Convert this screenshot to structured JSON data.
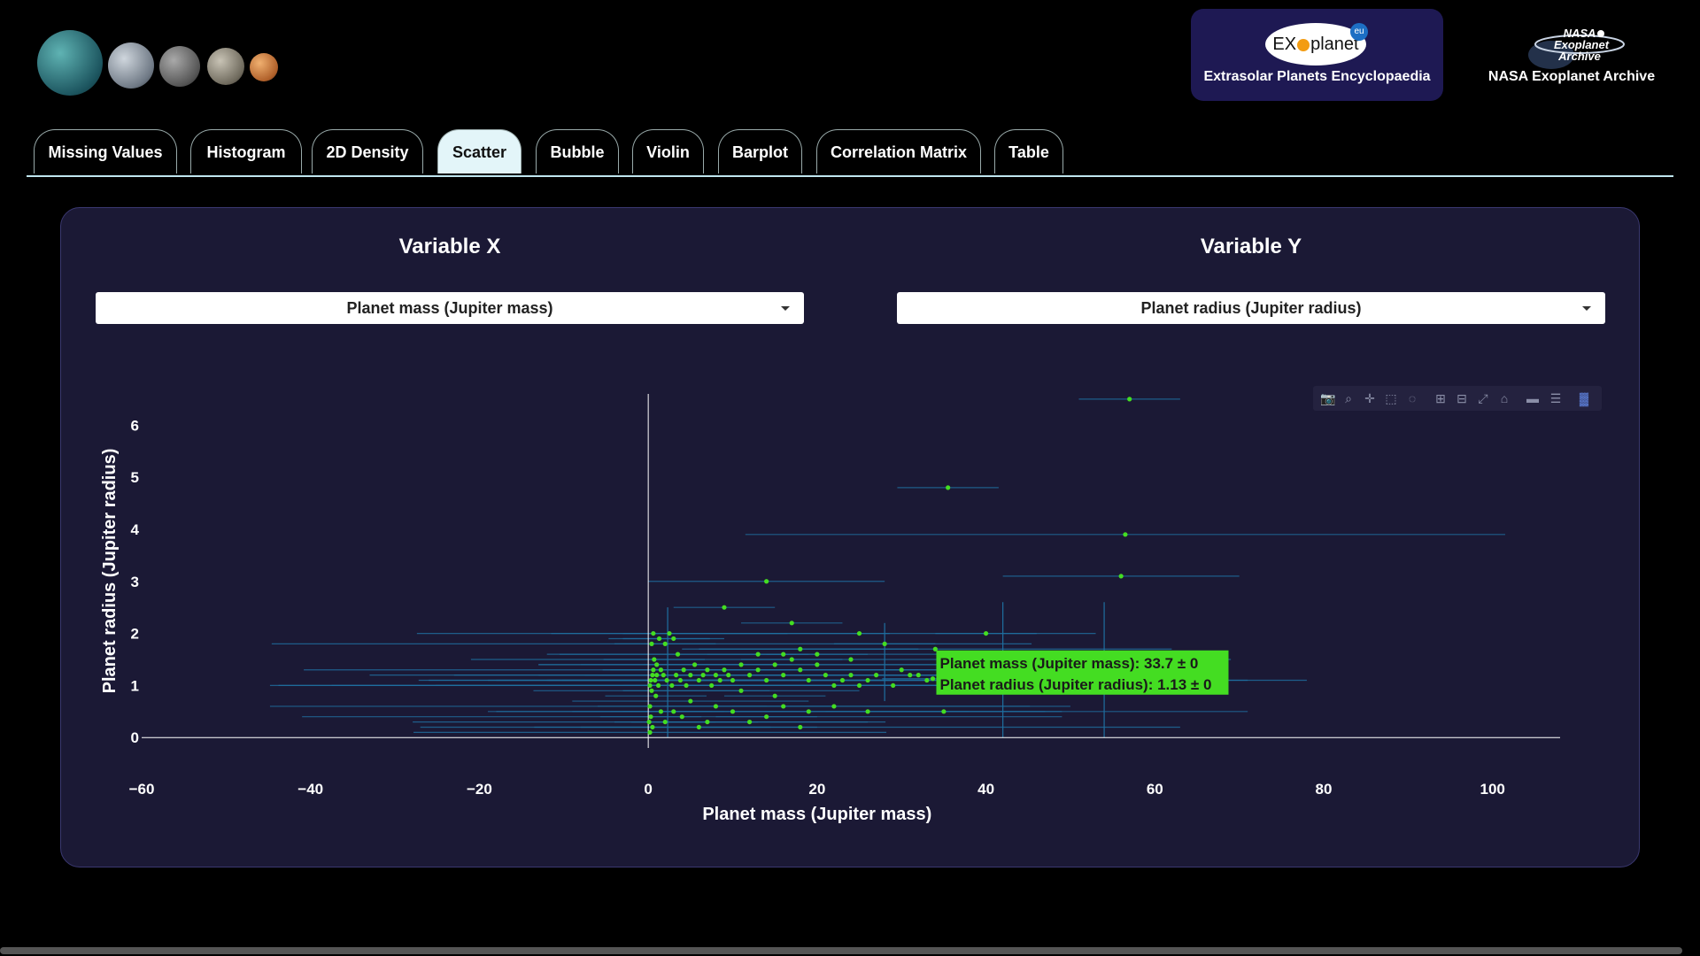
{
  "header": {
    "exoplanet_logo": {
      "brand": "EXOplanet",
      "suffix": "eu",
      "caption": "Extrasolar Planets Encyclopaedia"
    },
    "nasa_logo": {
      "brand_lines": [
        "NASA",
        "Exoplanet",
        "Archive"
      ],
      "caption": "NASA Exoplanet Archive"
    }
  },
  "tabs": [
    {
      "label": "Missing Values",
      "active": false
    },
    {
      "label": "Histogram",
      "active": false
    },
    {
      "label": "2D Density",
      "active": false
    },
    {
      "label": "Scatter",
      "active": true
    },
    {
      "label": "Bubble",
      "active": false
    },
    {
      "label": "Violin",
      "active": false
    },
    {
      "label": "Barplot",
      "active": false
    },
    {
      "label": "Correlation Matrix",
      "active": false
    },
    {
      "label": "Table",
      "active": false
    }
  ],
  "controls": {
    "x": {
      "title": "Variable X",
      "selected": "Planet mass (Jupiter mass)"
    },
    "y": {
      "title": "Variable Y",
      "selected": "Planet radius (Jupiter radius)"
    }
  },
  "modebar": [
    "camera-icon",
    "zoom-icon",
    "pan-icon",
    "box-select-icon",
    "lasso-icon",
    "zoom-in-icon",
    "zoom-out-icon",
    "autoscale-icon",
    "reset-axes-icon",
    "spike-lines-icon",
    "compare-hover-icon",
    "plotly-logo-icon"
  ],
  "colors": {
    "marker": "#44dd22",
    "error_bar": "#1f6fa0",
    "panel": "#1b1935",
    "tooltip_bg": "#44dd22"
  },
  "chart_data": {
    "type": "scatter",
    "xlabel": "Planet mass (Jupiter mass)",
    "ylabel": "Planet radius (Jupiter radius)",
    "xlim": [
      -60,
      108
    ],
    "ylim": [
      -0.2,
      6.6
    ],
    "xticks": [
      -60,
      -40,
      -20,
      0,
      20,
      40,
      60,
      80,
      100
    ],
    "yticks": [
      0,
      1,
      2,
      3,
      4,
      5,
      6
    ],
    "grid": false,
    "error_bars": "horizontal x-uncertainty and vertical y-uncertainty",
    "points": [
      [
        0.2,
        1.0
      ],
      [
        0.3,
        1.1
      ],
      [
        0.5,
        1.2
      ],
      [
        0.4,
        0.9
      ],
      [
        0.6,
        1.3
      ],
      [
        0.8,
        1.1
      ],
      [
        1.0,
        1.2
      ],
      [
        1.2,
        1.0
      ],
      [
        0.3,
        0.4
      ],
      [
        0.5,
        0.2
      ],
      [
        0.2,
        0.1
      ],
      [
        0.7,
        1.5
      ],
      [
        1.0,
        1.4
      ],
      [
        1.5,
        1.3
      ],
      [
        0.4,
        1.8
      ],
      [
        0.6,
        2.0
      ],
      [
        1.3,
        1.9
      ],
      [
        2.0,
        1.8
      ],
      [
        2.5,
        2.0
      ],
      [
        3.0,
        1.9
      ],
      [
        0.1,
        0.3
      ],
      [
        0.2,
        0.6
      ],
      [
        0.9,
        0.8
      ],
      [
        1.8,
        1.2
      ],
      [
        2.2,
        1.1
      ],
      [
        2.8,
        1.0
      ],
      [
        3.3,
        1.2
      ],
      [
        3.8,
        1.1
      ],
      [
        4.2,
        1.3
      ],
      [
        4.5,
        1.0
      ],
      [
        5.0,
        1.2
      ],
      [
        5.5,
        1.4
      ],
      [
        6.0,
        1.1
      ],
      [
        6.5,
        1.2
      ],
      [
        7.0,
        1.3
      ],
      [
        7.5,
        1.0
      ],
      [
        8.0,
        1.2
      ],
      [
        8.5,
        1.1
      ],
      [
        9.0,
        1.3
      ],
      [
        9.5,
        1.2
      ],
      [
        10.0,
        1.1
      ],
      [
        11.0,
        1.4
      ],
      [
        12.0,
        1.2
      ],
      [
        13.0,
        1.3
      ],
      [
        14.0,
        1.1
      ],
      [
        15.0,
        1.4
      ],
      [
        16.0,
        1.2
      ],
      [
        17.0,
        1.5
      ],
      [
        18.0,
        1.3
      ],
      [
        19.0,
        1.1
      ],
      [
        20.0,
        1.4
      ],
      [
        21.0,
        1.2
      ],
      [
        22.0,
        1.0
      ],
      [
        23.0,
        1.1
      ],
      [
        24.0,
        1.2
      ],
      [
        25.0,
        1.0
      ],
      [
        26.0,
        1.1
      ],
      [
        27.0,
        1.2
      ],
      [
        28.0,
        1.8
      ],
      [
        29.0,
        1.0
      ],
      [
        30.0,
        1.3
      ],
      [
        31.0,
        1.2
      ],
      [
        32.0,
        1.2
      ],
      [
        33.0,
        1.1
      ],
      [
        33.7,
        1.13
      ],
      [
        34.0,
        1.7
      ],
      [
        35.0,
        0.5
      ],
      [
        35.5,
        4.8
      ],
      [
        40.0,
        2.0
      ],
      [
        56.0,
        3.1
      ],
      [
        56.5,
        3.9
      ],
      [
        57.0,
        6.5
      ],
      [
        14.0,
        3.0
      ],
      [
        9.0,
        2.5
      ],
      [
        17.0,
        2.2
      ],
      [
        25.0,
        2.0
      ],
      [
        2.0,
        0.3
      ],
      [
        4.0,
        0.4
      ],
      [
        6.0,
        0.2
      ],
      [
        8.0,
        0.6
      ],
      [
        10.0,
        0.5
      ],
      [
        12.0,
        0.3
      ],
      [
        14.0,
        0.4
      ],
      [
        16.0,
        0.6
      ],
      [
        18.0,
        0.2
      ],
      [
        19.0,
        0.5
      ],
      [
        3.0,
        0.5
      ],
      [
        5.0,
        0.7
      ],
      [
        7.0,
        0.3
      ],
      [
        1.5,
        0.5
      ],
      [
        22.0,
        0.6
      ],
      [
        26.0,
        0.5
      ],
      [
        15.0,
        0.8
      ],
      [
        11.0,
        0.9
      ],
      [
        13.0,
        1.6
      ],
      [
        16.0,
        1.6
      ],
      [
        18.0,
        1.7
      ],
      [
        20.0,
        1.6
      ],
      [
        24.0,
        1.5
      ],
      [
        3.5,
        1.6
      ]
    ],
    "tooltip": {
      "x_line": "Planet mass (Jupiter mass): 33.7 ± 0",
      "y_line": "Planet radius (Jupiter radius): 1.13 ± 0"
    }
  }
}
